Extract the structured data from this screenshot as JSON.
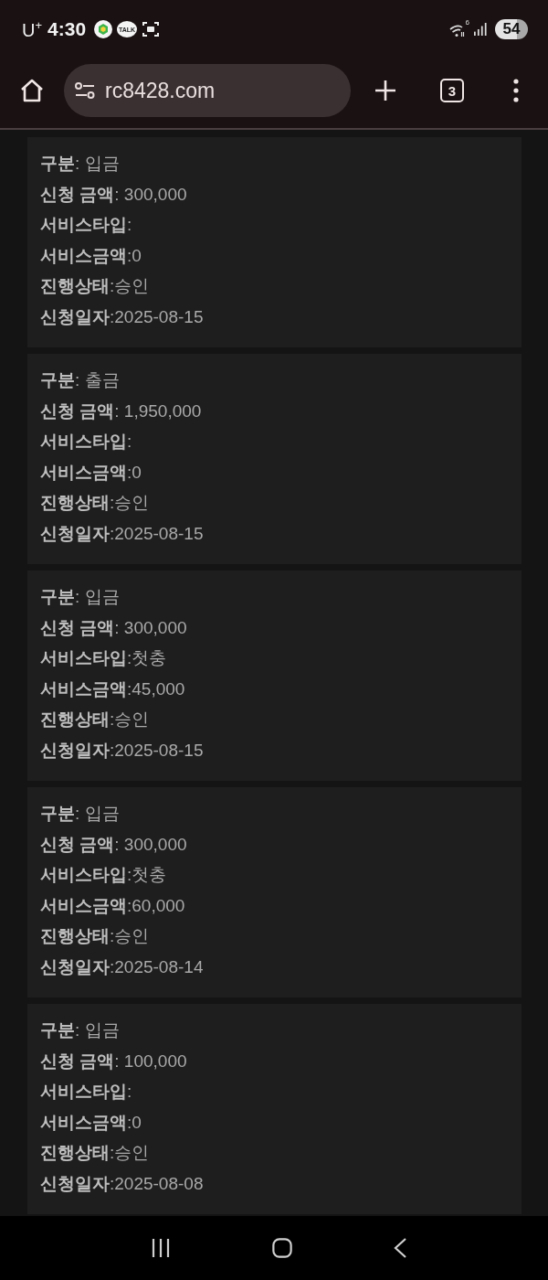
{
  "status_bar": {
    "carrier": "U$^{+}$",
    "time": "4:30",
    "notifications": [
      {
        "kind": "app"
      },
      {
        "kind": "talk",
        "label": "TALK"
      },
      {
        "kind": "capture"
      }
    ],
    "wifi_badge": "6",
    "battery": "54"
  },
  "browser_bar": {
    "url": "rc8428.com",
    "tab_count": "3"
  },
  "cards": [
    {
      "lines": [
        "**구분**: 입금",
        "**신청 금액**: 300,000",
        "**서비스타입**:",
        "**서비스금액**:0",
        "**진행상태**:승인",
        "**신청일자**:2025-08-15"
      ]
    },
    {
      "lines": [
        "**구분**: 출금",
        "**신청 금액**: 1,950,000",
        "**서비스타입**:",
        "**서비스금액**:0",
        "**진행상태**:승인",
        "**신청일자**:2025-08-15"
      ]
    },
    {
      "lines": [
        "**구분**: 입금",
        "**신청 금액**: 300,000",
        "**서비스타입**:첫충",
        "**서비스금액**:45,000",
        "**진행상태**:승인",
        "**신청일자**:2025-08-15"
      ]
    },
    {
      "lines": [
        "**구분**: 입금",
        "**신청 금액**: 300,000",
        "**서비스타입**:첫충",
        "**서비스금액**:60,000",
        "**진행상태**:승인",
        "**신청일자**:2025-08-14"
      ]
    },
    {
      "lines": [
        "**구분**: 입금",
        "**신청 금액**: 100,000",
        "**서비스타입**:",
        "**서비스금액**:0",
        "**진행상태**:승인",
        "**신청일자**:2025-08-08"
      ]
    }
  ]
}
